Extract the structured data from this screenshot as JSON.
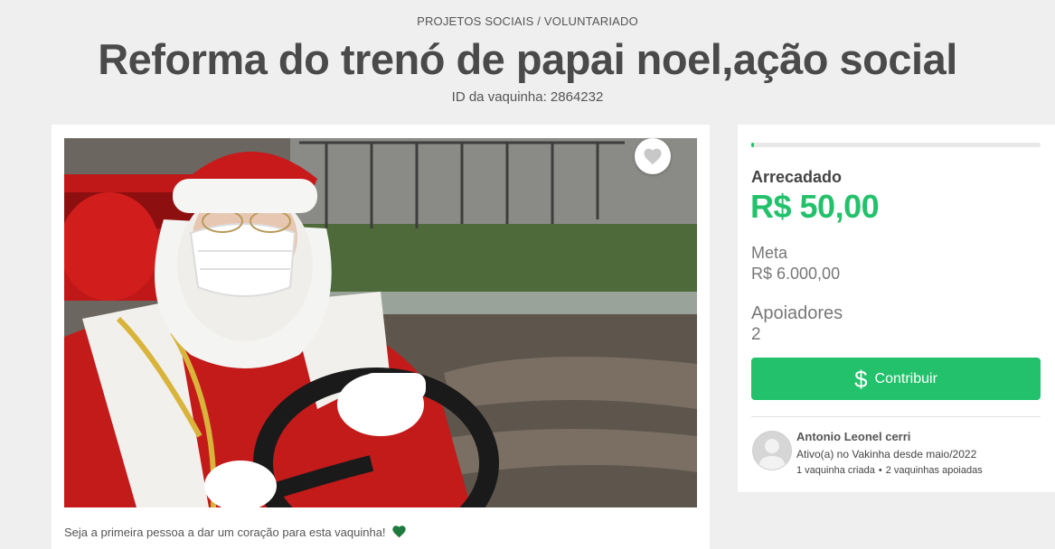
{
  "header": {
    "category": "PROJETOS SOCIAIS / VOLUNTARIADO",
    "title": "Reforma do trenó de papai noel,ação social",
    "campaign_id": "ID da vaquinha: 2864232"
  },
  "main": {
    "photo_icon": "campaign-photo",
    "favorite_icon": "heart-icon",
    "first_heart_text": "Seja a primeira pessoa a dar um coração para esta vaquinha!",
    "first_heart_icon": "green-heart-icon"
  },
  "sidebar": {
    "progress_fraction": 0.008,
    "raised_label": "Arrecadado",
    "raised_amount": "R$ 50,00",
    "goal_label": "Meta",
    "goal_amount": "R$ 6.000,00",
    "supporters_label": "Apoiadores",
    "supporters_count": "2",
    "contribute_icon": "dollar-icon",
    "contribute_symbol": "$",
    "contribute_label": "Contribuir",
    "author": {
      "avatar_icon": "default-avatar",
      "name": "Antonio Leonel cerri",
      "since": "Ativo(a) no Vakinha desde maio/2022",
      "campaigns_created": "1 vaquinha criada",
      "separator": "•",
      "campaigns_supported": "2 vaquinhas apoiadas"
    }
  },
  "colors": {
    "accent_green": "#23c16b",
    "page_background": "#efefef",
    "card_background": "#ffffff",
    "title_text": "#4a4a4a"
  }
}
